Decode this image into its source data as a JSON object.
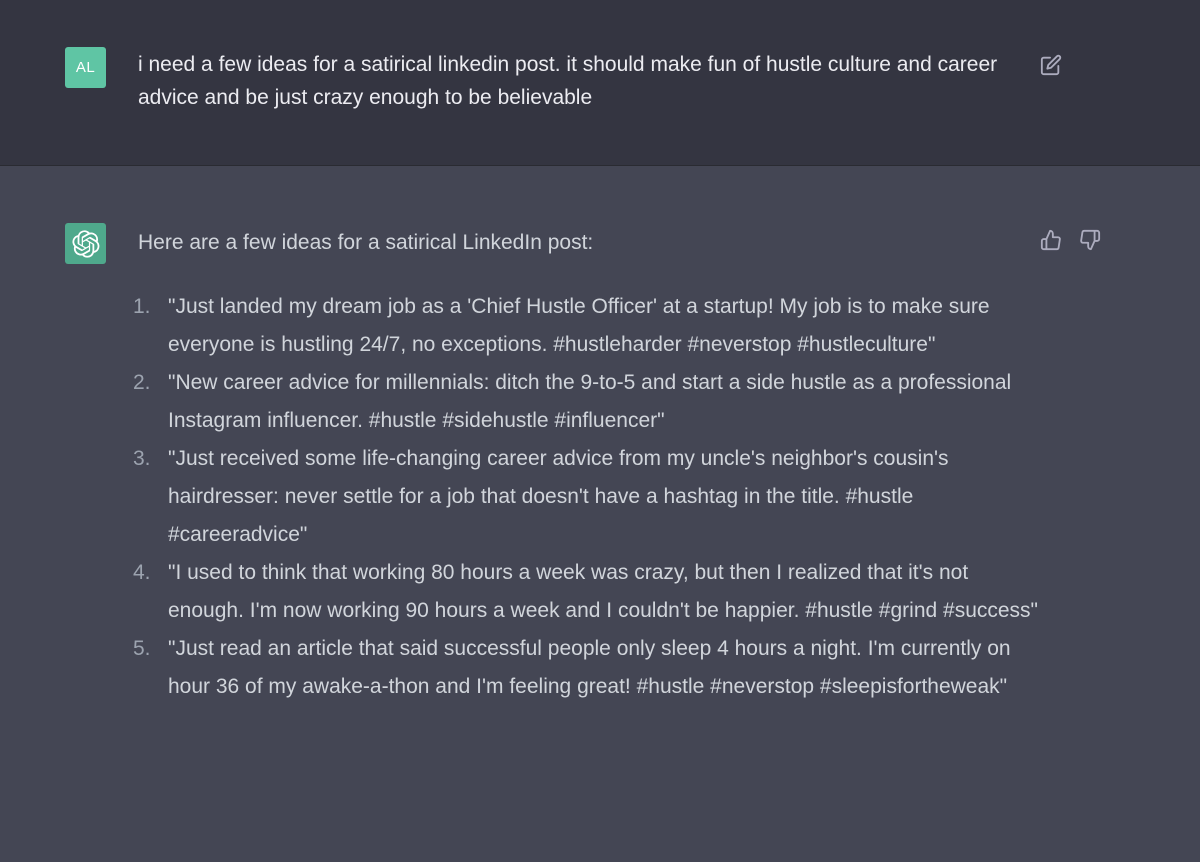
{
  "user_message": {
    "avatar_initials": "AL",
    "text": "i need a few ideas for a satirical linkedin post. it should make fun of hustle culture and career advice and be just crazy enough to be believable",
    "edit_icon": "edit-icon"
  },
  "assistant_message": {
    "avatar_icon": "openai-logo-icon",
    "intro": "Here are a few ideas for a satirical LinkedIn post:",
    "items": [
      {
        "number": "1.",
        "text": "\"Just landed my dream job as a 'Chief Hustle Officer' at a startup! My job is to make sure everyone is hustling 24/7, no exceptions. #hustleharder #neverstop #hustleculture\""
      },
      {
        "number": "2.",
        "text": "\"New career advice for millennials: ditch the 9-to-5 and start a side hustle as a professional Instagram influencer. #hustle #sidehustle #influencer\""
      },
      {
        "number": "3.",
        "text": "\"Just received some life-changing career advice from my uncle's neighbor's cousin's hairdresser: never settle for a job that doesn't have a hashtag in the title. #hustle #careeradvice\""
      },
      {
        "number": "4.",
        "text": "\"I used to think that working 80 hours a week was crazy, but then I realized that it's not enough. I'm now working 90 hours a week and I couldn't be happier. #hustle #grind #success\""
      },
      {
        "number": "5.",
        "text": "\"Just read an article that said successful people only sleep 4 hours a night. I'm currently on hour 36 of my awake-a-thon and I'm feeling great! #hustle #neverstop #sleepisfortheweak\""
      }
    ],
    "feedback_icons": [
      "thumbs-up-icon",
      "thumbs-down-icon"
    ]
  },
  "colors": {
    "user_bg": "#343541",
    "assistant_bg": "#444654",
    "user_avatar": "#5fc5a4",
    "bot_avatar": "#4fa98c",
    "text": "#ececf1"
  }
}
